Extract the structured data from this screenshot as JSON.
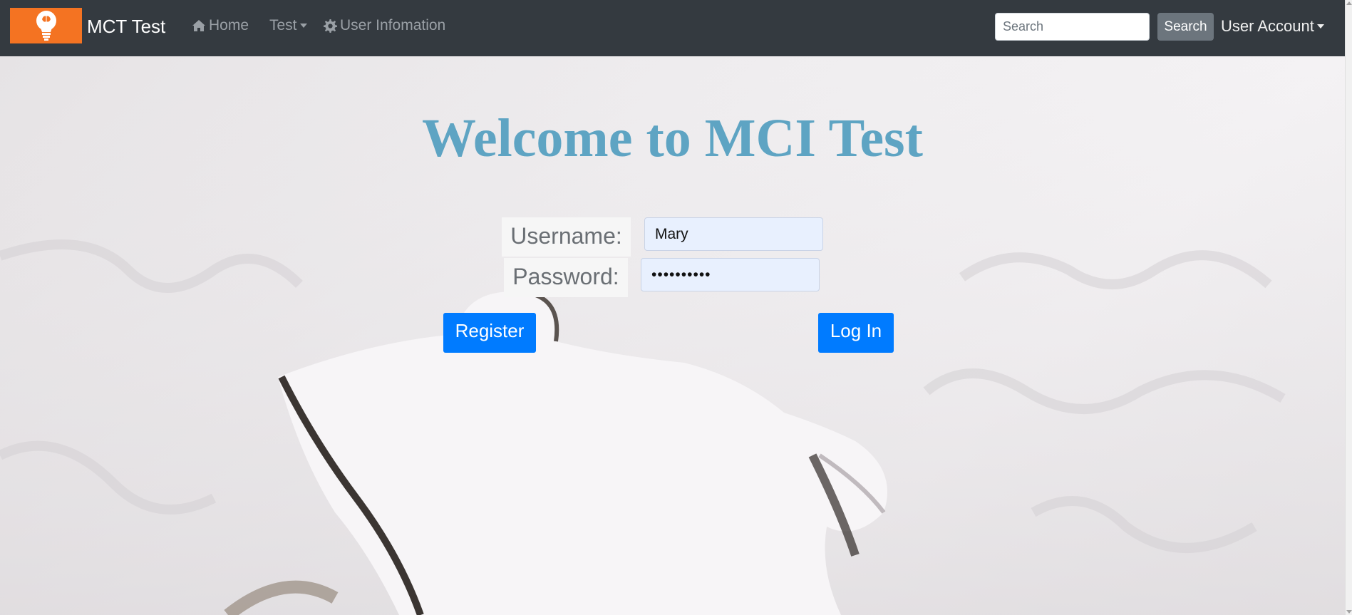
{
  "navbar": {
    "brand": "MCT Test",
    "logo_icon": "lightbulb-icon",
    "home_label": "Home",
    "test_label": "Test",
    "user_info_label": "User Infomation",
    "search_placeholder": "Search",
    "search_button": "Search",
    "account_label": "User Account"
  },
  "main": {
    "title": "Welcome to MCI Test",
    "username_label": "Username:",
    "username_value": "Mary",
    "password_label": "Password:",
    "password_value": "••••••••••",
    "register_button": "Register",
    "login_button": "Log In"
  },
  "colors": {
    "navbar_bg": "#343a40",
    "logo_bg": "#f47322",
    "title": "#5ea4c3",
    "primary_button": "#007bff",
    "search_button": "#6c757d",
    "input_autofill": "#e8f0fe"
  }
}
